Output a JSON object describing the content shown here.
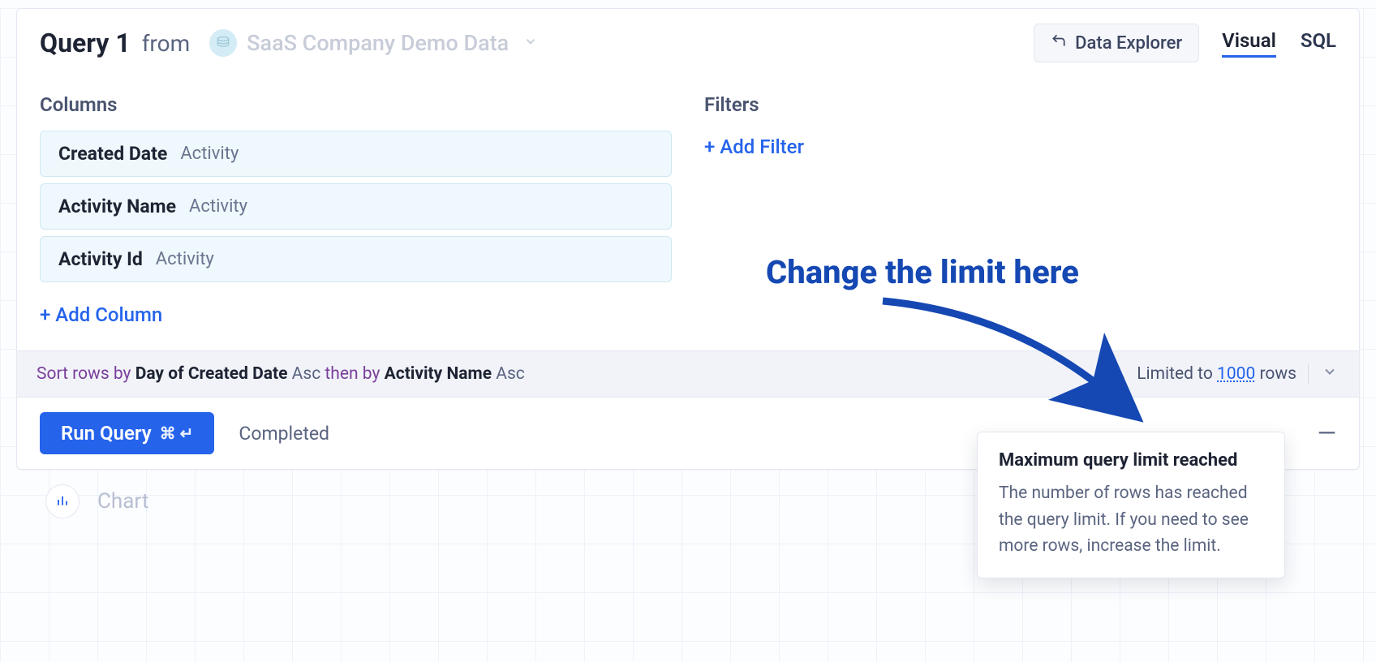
{
  "header": {
    "query_title": "Query 1",
    "from_word": "from",
    "datasource_name": "SaaS Company Demo Data",
    "explorer_label": "Data Explorer",
    "tab_visual": "Visual",
    "tab_sql": "SQL"
  },
  "columns": {
    "title": "Columns",
    "items": [
      {
        "name": "Created Date",
        "table": "Activity"
      },
      {
        "name": "Activity Name",
        "table": "Activity"
      },
      {
        "name": "Activity Id",
        "table": "Activity"
      }
    ],
    "add_label": "+ Add Column"
  },
  "filters": {
    "title": "Filters",
    "add_label": "+ Add Filter"
  },
  "sort": {
    "prefix": "Sort rows by",
    "field1": "Day of Created Date",
    "dir1": "Asc",
    "then": "then by",
    "field2": "Activity Name",
    "dir2": "Asc"
  },
  "limit": {
    "prefix": "Limited to",
    "value": "1000",
    "suffix": "rows"
  },
  "run": {
    "button": "Run Query",
    "shortcut": "⌘ ↵",
    "status": "Completed"
  },
  "chart": {
    "label": "Chart"
  },
  "tooltip": {
    "title": "Maximum query limit reached",
    "body": "The number of rows has reached the query limit. If you need to see more rows, increase the limit."
  },
  "annotation": {
    "text": "Change the limit here"
  }
}
